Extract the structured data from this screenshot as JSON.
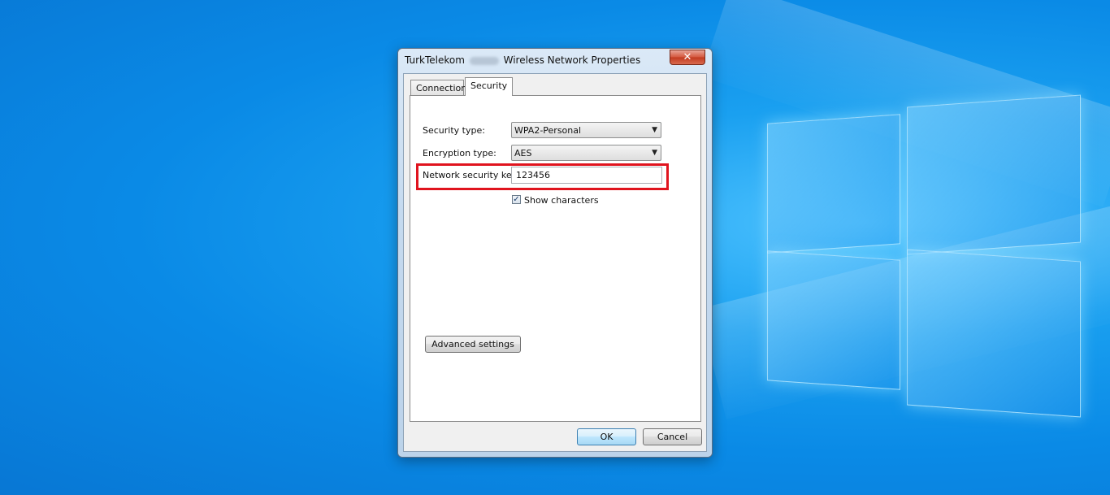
{
  "window": {
    "title_prefix": "TurkTelekom",
    "title_suffix": "Wireless Network Properties",
    "close_glyph": "✕"
  },
  "tabs": [
    {
      "label": "Connection",
      "selected": false
    },
    {
      "label": "Security",
      "selected": true
    }
  ],
  "security": {
    "security_type_label": "Security type:",
    "security_type_value": "WPA2-Personal",
    "encryption_type_label": "Encryption type:",
    "encryption_type_value": "AES",
    "network_key_label": "Network security key",
    "network_key_value": "123456",
    "show_characters_label": "Show characters",
    "show_characters_checked": true,
    "checkbox_glyph": "✓",
    "dropdown_glyph": "▼"
  },
  "buttons": {
    "advanced_settings": "Advanced settings",
    "ok": "OK",
    "cancel": "Cancel"
  },
  "colors": {
    "highlight": "#e0141e",
    "desktop_blue": "#0a8ae6"
  }
}
